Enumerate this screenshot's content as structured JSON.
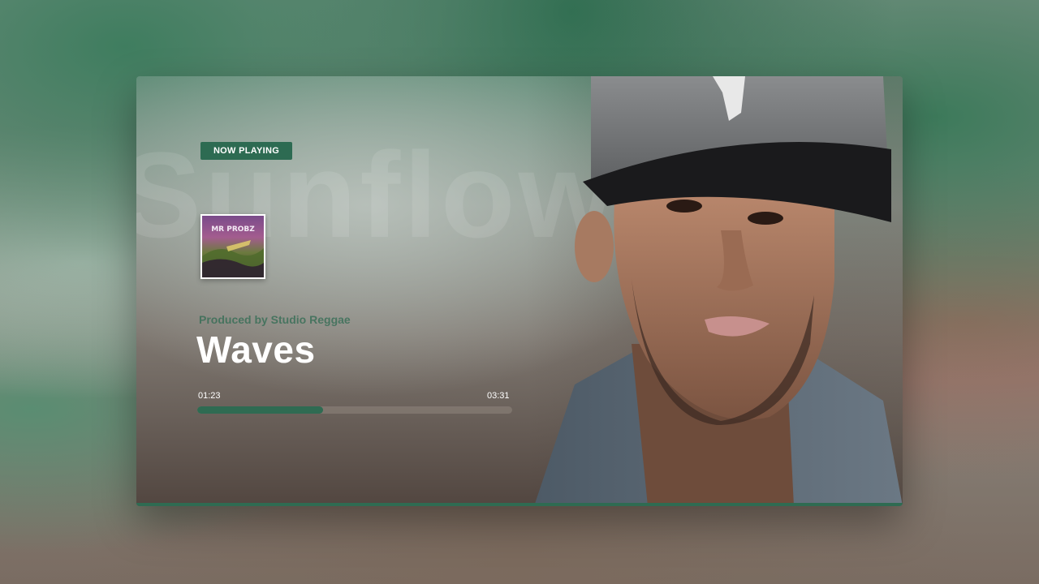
{
  "ghost_word": "Sunflow",
  "badge": {
    "label": "NOW PLAYING"
  },
  "album": {
    "cover_text": "MR PROBZ"
  },
  "track": {
    "producer": "Produced by Studio Reggae",
    "title": "Waves"
  },
  "playback": {
    "current_time": "01:23",
    "total_time": "03:31",
    "progress_fraction": 0.4
  },
  "colors": {
    "accent": "#2f6b52",
    "text": "#ffffff"
  },
  "icons": [
    "artist-photo",
    "album-cover"
  ]
}
